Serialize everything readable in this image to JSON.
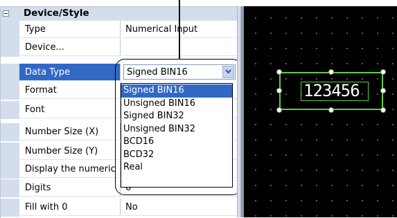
{
  "category": {
    "title": "Device/Style"
  },
  "properties": [
    {
      "name": "Type",
      "value": "Numerical Input"
    },
    {
      "name": "Device...",
      "value": ""
    },
    {
      "name": "Data Type",
      "value": "Signed BIN16"
    },
    {
      "name": "Format",
      "value": ""
    },
    {
      "name": "Font",
      "value": ""
    },
    {
      "name": "Number Size (X)",
      "value": ""
    },
    {
      "name": "Number Size (Y)",
      "value": ""
    },
    {
      "name": "Display the numeric",
      "value": ""
    },
    {
      "name": "Digits",
      "value": "6"
    },
    {
      "name": "Fill with 0",
      "value": "No"
    }
  ],
  "data_type_dropdown": {
    "selected": "Signed BIN16",
    "options": [
      "Signed BIN16",
      "Unsigned BIN16",
      "Signed BIN32",
      "Unsigned BIN32",
      "BCD16",
      "BCD32",
      "Real"
    ]
  },
  "canvas": {
    "numeric_display": "123456"
  },
  "colors": {
    "selection": "#3168c6",
    "object_outline": "#5cd13a",
    "canvas_bg": "#000000"
  }
}
